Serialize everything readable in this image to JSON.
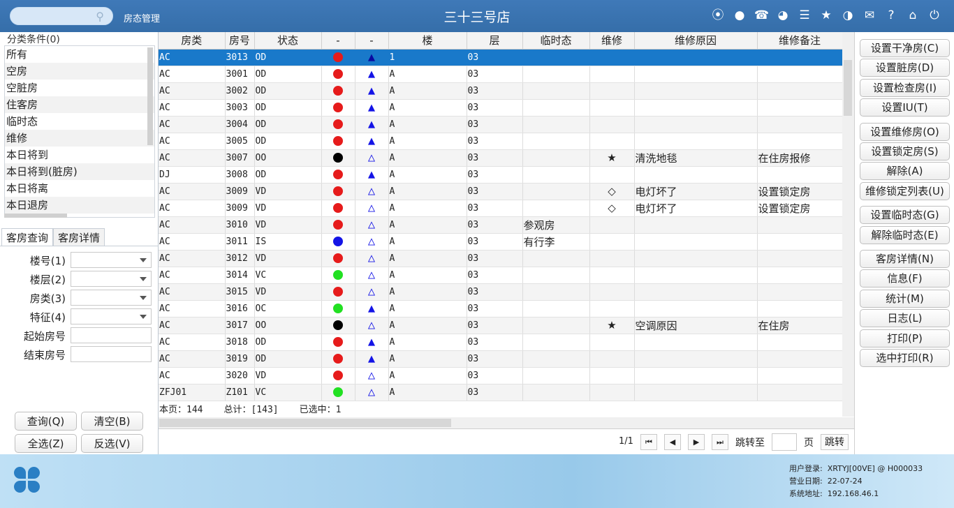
{
  "header": {
    "search_icon": "search-icon",
    "module": "房态管理",
    "store": "三十三号店",
    "icons": [
      "wifi-icon",
      "chat-icon",
      "phone-icon",
      "palette-icon",
      "menu-icon",
      "star-icon",
      "theme-icon",
      "mail-icon",
      "help-icon",
      "home-icon",
      "power-icon"
    ]
  },
  "category": {
    "title": "分类条件(0)",
    "items": [
      "所有",
      "空房",
      "空脏房",
      "住客房",
      "临时态",
      "维修",
      "本日将到",
      "本日将到(脏房)",
      "本日将离",
      "本日退房"
    ]
  },
  "tabs": [
    "客房查询",
    "客房详情"
  ],
  "filters": {
    "building": "楼号(1)",
    "floor": "楼层(2)",
    "roomtype": "房类(3)",
    "feature": "特征(4)",
    "start": "起始房号",
    "end": "结束房号"
  },
  "left_buttons": {
    "query": "查询(Q)",
    "clear": "清空(B)",
    "select_all": "全选(Z)",
    "invert": "反选(V)"
  },
  "colors": {
    "red": "#e61b1b",
    "black": "#000000",
    "blue": "#1414e6",
    "green": "#22e022",
    "selected": "#1979ca"
  },
  "table": {
    "columns": [
      "房类",
      "房号",
      "状态",
      "-",
      "-",
      "楼",
      "层",
      "临时态",
      "维修",
      "维修原因",
      "维修备注"
    ],
    "rows": [
      {
        "type": "AC",
        "room": "3013",
        "status": "OD",
        "dot": "red",
        "tri": "solid",
        "building": "1",
        "floor": "03",
        "temp": "",
        "repair": "",
        "reason": "",
        "note": ""
      },
      {
        "type": "AC",
        "room": "3001",
        "status": "OD",
        "dot": "red",
        "tri": "solid",
        "building": "A",
        "floor": "03",
        "temp": "",
        "repair": "",
        "reason": "",
        "note": ""
      },
      {
        "type": "AC",
        "room": "3002",
        "status": "OD",
        "dot": "red",
        "tri": "solid",
        "building": "A",
        "floor": "03",
        "temp": "",
        "repair": "",
        "reason": "",
        "note": ""
      },
      {
        "type": "AC",
        "room": "3003",
        "status": "OD",
        "dot": "red",
        "tri": "solid",
        "building": "A",
        "floor": "03",
        "temp": "",
        "repair": "",
        "reason": "",
        "note": ""
      },
      {
        "type": "AC",
        "room": "3004",
        "status": "OD",
        "dot": "red",
        "tri": "solid",
        "building": "A",
        "floor": "03",
        "temp": "",
        "repair": "",
        "reason": "",
        "note": ""
      },
      {
        "type": "AC",
        "room": "3005",
        "status": "OD",
        "dot": "red",
        "tri": "solid",
        "building": "A",
        "floor": "03",
        "temp": "",
        "repair": "",
        "reason": "",
        "note": ""
      },
      {
        "type": "AC",
        "room": "3007",
        "status": "OO",
        "dot": "black",
        "tri": "outline",
        "building": "A",
        "floor": "03",
        "temp": "",
        "repair": "★",
        "reason": "清洗地毯",
        "note": "在住房报修"
      },
      {
        "type": "DJ",
        "room": "3008",
        "status": "OD",
        "dot": "red",
        "tri": "solid",
        "building": "A",
        "floor": "03",
        "temp": "",
        "repair": "",
        "reason": "",
        "note": ""
      },
      {
        "type": "AC",
        "room": "3009",
        "status": "VD",
        "dot": "red",
        "tri": "outline",
        "building": "A",
        "floor": "03",
        "temp": "",
        "repair": "◇",
        "reason": "电灯坏了",
        "note": "设置锁定房"
      },
      {
        "type": "AC",
        "room": "3009",
        "status": "VD",
        "dot": "red",
        "tri": "outline",
        "building": "A",
        "floor": "03",
        "temp": "",
        "repair": "◇",
        "reason": "电灯坏了",
        "note": "设置锁定房"
      },
      {
        "type": "AC",
        "room": "3010",
        "status": "VD",
        "dot": "red",
        "tri": "outline",
        "building": "A",
        "floor": "03",
        "temp": "参观房",
        "repair": "",
        "reason": "",
        "note": ""
      },
      {
        "type": "AC",
        "room": "3011",
        "status": "IS",
        "dot": "blue",
        "tri": "outline",
        "building": "A",
        "floor": "03",
        "temp": "有行李",
        "repair": "",
        "reason": "",
        "note": ""
      },
      {
        "type": "AC",
        "room": "3012",
        "status": "VD",
        "dot": "red",
        "tri": "outline",
        "building": "A",
        "floor": "03",
        "temp": "",
        "repair": "",
        "reason": "",
        "note": ""
      },
      {
        "type": "AC",
        "room": "3014",
        "status": "VC",
        "dot": "green",
        "tri": "outline",
        "building": "A",
        "floor": "03",
        "temp": "",
        "repair": "",
        "reason": "",
        "note": ""
      },
      {
        "type": "AC",
        "room": "3015",
        "status": "VD",
        "dot": "red",
        "tri": "outline",
        "building": "A",
        "floor": "03",
        "temp": "",
        "repair": "",
        "reason": "",
        "note": ""
      },
      {
        "type": "AC",
        "room": "3016",
        "status": "OC",
        "dot": "green",
        "tri": "solid",
        "building": "A",
        "floor": "03",
        "temp": "",
        "repair": "",
        "reason": "",
        "note": ""
      },
      {
        "type": "AC",
        "room": "3017",
        "status": "OO",
        "dot": "black",
        "tri": "outline",
        "building": "A",
        "floor": "03",
        "temp": "",
        "repair": "★",
        "reason": "空调原因",
        "note": "在住房"
      },
      {
        "type": "AC",
        "room": "3018",
        "status": "OD",
        "dot": "red",
        "tri": "solid",
        "building": "A",
        "floor": "03",
        "temp": "",
        "repair": "",
        "reason": "",
        "note": ""
      },
      {
        "type": "AC",
        "room": "3019",
        "status": "OD",
        "dot": "red",
        "tri": "solid",
        "building": "A",
        "floor": "03",
        "temp": "",
        "repair": "",
        "reason": "",
        "note": ""
      },
      {
        "type": "AC",
        "room": "3020",
        "status": "VD",
        "dot": "red",
        "tri": "outline",
        "building": "A",
        "floor": "03",
        "temp": "",
        "repair": "",
        "reason": "",
        "note": ""
      },
      {
        "type": "ZFJ01",
        "room": "Z101",
        "status": "VC",
        "dot": "green",
        "tri": "outline",
        "building": "A",
        "floor": "03",
        "temp": "",
        "repair": "",
        "reason": "",
        "note": ""
      }
    ]
  },
  "summary": {
    "page": "本页：144",
    "total": "总计：[143]",
    "selected": "已选中：1"
  },
  "pager": {
    "page": "1/1",
    "jump": "跳转至",
    "unit": "页",
    "go": "跳转"
  },
  "actions": [
    {
      "label": "设置干净房(C)",
      "gap": false
    },
    {
      "label": "设置脏房(D)",
      "gap": false
    },
    {
      "label": "设置检查房(I)",
      "gap": false
    },
    {
      "label": "设置IU(T)",
      "gap": false
    },
    {
      "label": "设置维修房(O)",
      "gap": true
    },
    {
      "label": "设置锁定房(S)",
      "gap": false
    },
    {
      "label": "解除(A)",
      "gap": false
    },
    {
      "label": "维修锁定列表(U)",
      "gap": false
    },
    {
      "label": "设置临时态(G)",
      "gap": true
    },
    {
      "label": "解除临时态(E)",
      "gap": false
    },
    {
      "label": "客房详情(N)",
      "gap": true
    },
    {
      "label": "信息(F)",
      "gap": false
    },
    {
      "label": "统计(M)",
      "gap": false
    },
    {
      "label": "日志(L)",
      "gap": false
    },
    {
      "label": "打印(P)",
      "gap": false
    },
    {
      "label": "选中打印(R)",
      "gap": false
    }
  ],
  "footer": {
    "login_label": "用户登录:",
    "login": "XRTYJ[00VE] @ H000033",
    "date_label": "营业日期:",
    "date": "22-07-24",
    "addr_label": "系统地址:",
    "addr": "192.168.46.1"
  }
}
